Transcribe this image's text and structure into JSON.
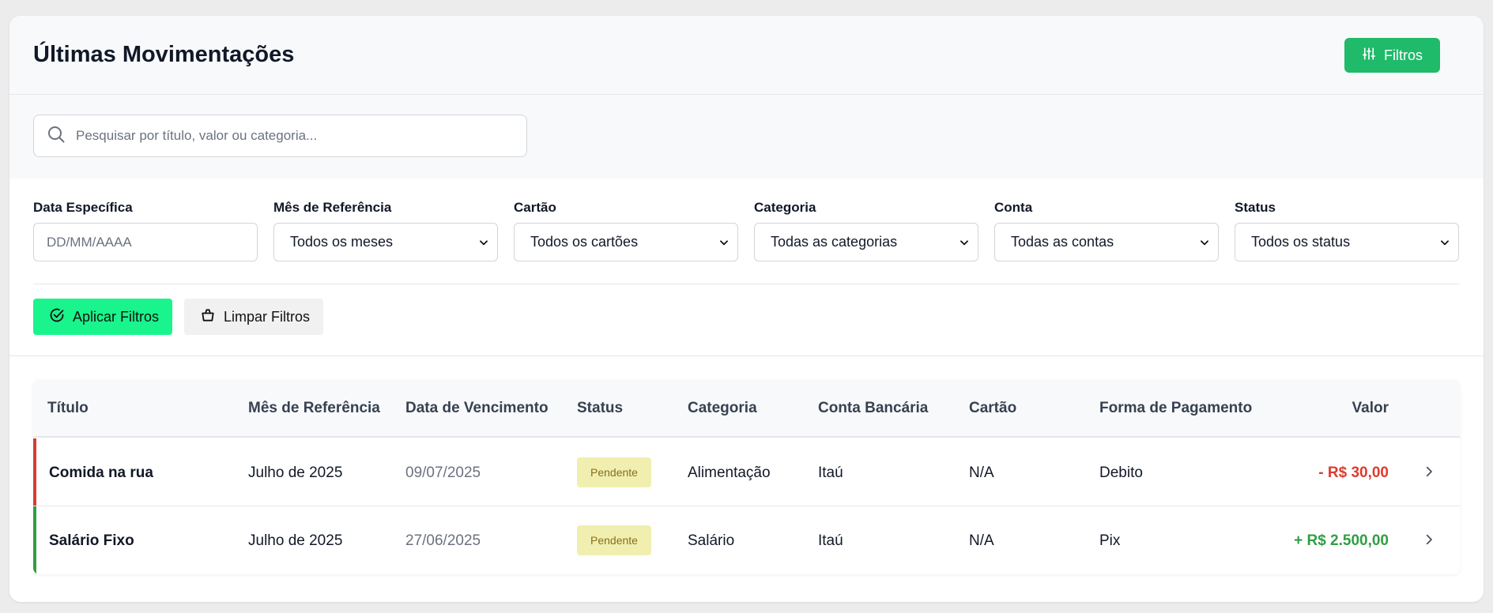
{
  "header": {
    "title": "Últimas Movimentações",
    "filters_button": "Filtros"
  },
  "search": {
    "placeholder": "Pesquisar por título, valor ou categoria..."
  },
  "filters": {
    "date": {
      "label": "Data Específica",
      "placeholder": "DD/MM/AAAA"
    },
    "month": {
      "label": "Mês de Referência",
      "value": "Todos os meses"
    },
    "card": {
      "label": "Cartão",
      "value": "Todos os cartões"
    },
    "category": {
      "label": "Categoria",
      "value": "Todas as categorias"
    },
    "account": {
      "label": "Conta",
      "value": "Todas as contas"
    },
    "status": {
      "label": "Status",
      "value": "Todos os status"
    }
  },
  "actions": {
    "apply": "Aplicar Filtros",
    "clear": "Limpar Filtros"
  },
  "table": {
    "columns": [
      "Título",
      "Mês de Referência",
      "Data de Vencimento",
      "Status",
      "Categoria",
      "Conta Bancária",
      "Cartão",
      "Forma de Pagamento",
      "Valor"
    ],
    "rows": [
      {
        "title": "Comida na rua",
        "month": "Julho de 2025",
        "due_date": "09/07/2025",
        "status": "Pendente",
        "category": "Alimentação",
        "account": "Itaú",
        "card": "N/A",
        "payment": "Debito",
        "value": "- R$ 30,00",
        "type": "expense"
      },
      {
        "title": "Salário Fixo",
        "month": "Julho de 2025",
        "due_date": "27/06/2025",
        "status": "Pendente",
        "category": "Salário",
        "account": "Itaú",
        "card": "N/A",
        "payment": "Pix",
        "value": "+ R$ 2.500,00",
        "type": "income"
      }
    ]
  },
  "colors": {
    "primary": "#1fba6a",
    "apply": "#19f58c",
    "expense": "#dc3b2f",
    "income": "#2f9e44",
    "badge_bg": "#f0efb0",
    "badge_text": "#8a6d1c"
  },
  "icons": {
    "filters": "sliders-icon",
    "search": "search-icon",
    "select": "chevron-down-icon",
    "apply": "check-circle-icon",
    "clear": "basket-icon",
    "row": "chevron-right-icon"
  }
}
